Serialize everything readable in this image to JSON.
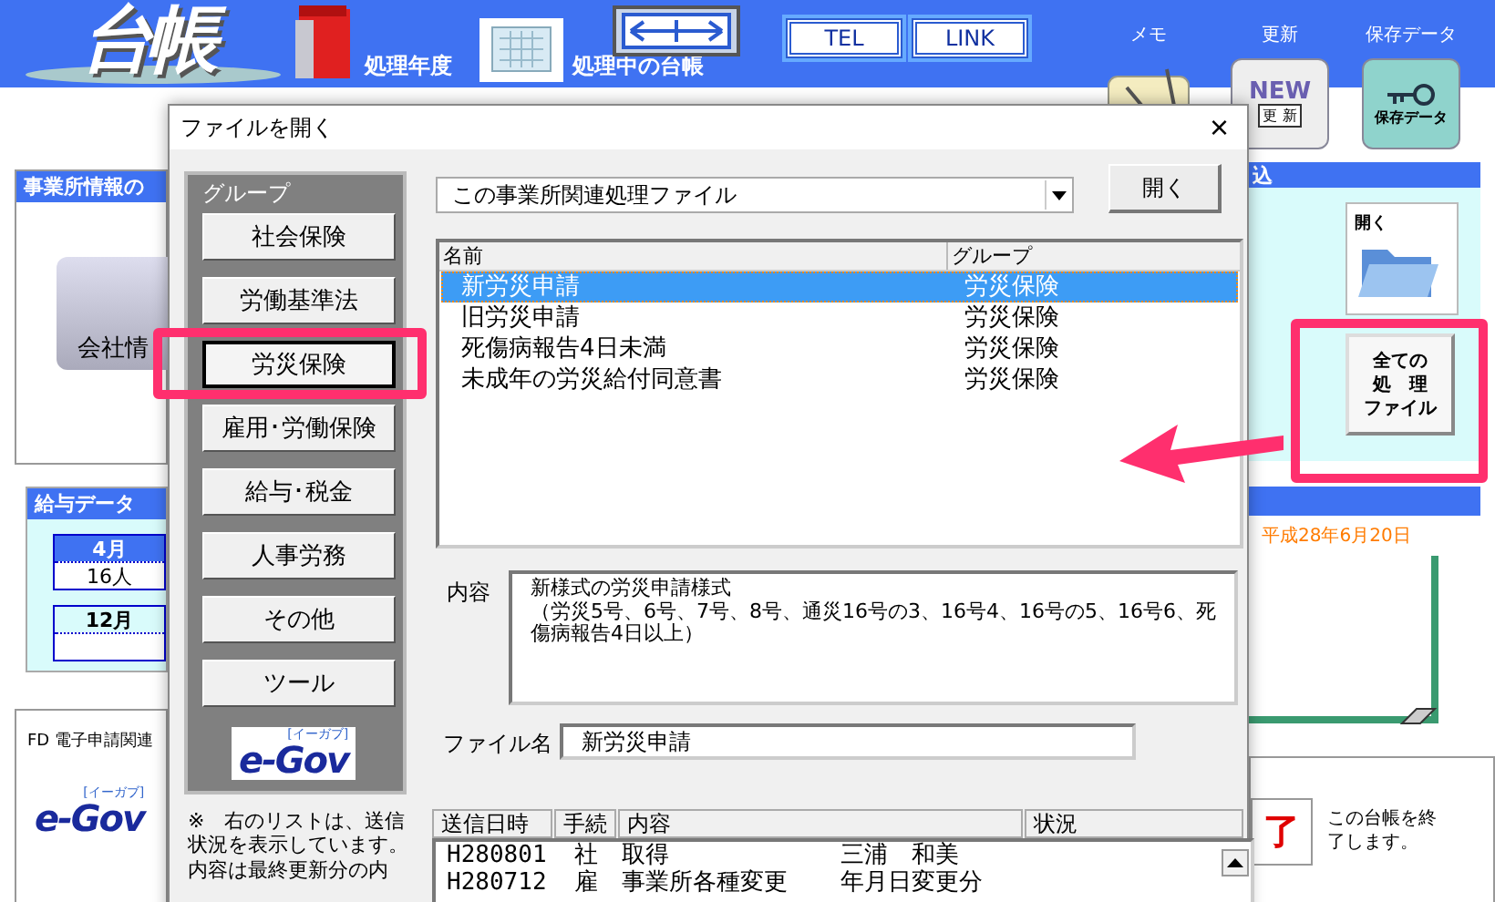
{
  "app": {
    "logo": "台帳",
    "year_label": "処理年度",
    "ledger_label": "処理中の台帳",
    "link_buttons": [
      "TEL",
      "LINK"
    ],
    "tools": [
      {
        "label": "メモ",
        "kind": "memo"
      },
      {
        "label": "更新",
        "kind": "update",
        "badge": "NEW",
        "icon_text": "更 新"
      },
      {
        "label": "保存データ",
        "kind": "save",
        "icon_text": "保存データ"
      }
    ]
  },
  "left": {
    "office_title": "事業所情報の",
    "company_label": "会社情",
    "salary_title": "給与データ",
    "salary_rows": [
      {
        "month": "4月",
        "count": "16人"
      },
      {
        "month": "12月"
      }
    ],
    "fd_title": "FD 電子申請関連",
    "egov": {
      "text": "e-Gov",
      "ruby": "[イーガブ]"
    }
  },
  "right": {
    "panel_title": "込",
    "open_label": "開く",
    "all_files_lines": [
      "全ての",
      "処　理",
      "ファイル"
    ],
    "date": "平成28年6月20日",
    "exit_mark": "了",
    "exit_note": "この台帳を終了します。"
  },
  "dialog": {
    "title": "ファイルを開く",
    "close": "×",
    "group_label": "グループ",
    "groups": [
      {
        "label": "社会保険",
        "selected": false
      },
      {
        "label": "労働基準法",
        "selected": false
      },
      {
        "label": "労災保険",
        "selected": true
      },
      {
        "label": "雇用･労働保険",
        "selected": false
      },
      {
        "label": "給与･税金",
        "selected": false
      },
      {
        "label": "人事労務",
        "selected": false
      },
      {
        "label": "その他",
        "selected": false
      },
      {
        "label": "ツール",
        "selected": false
      }
    ],
    "egov": {
      "text": "e-Gov",
      "ruby": "[イーガブ]"
    },
    "note": "※　右のリストは、送信状況を表示しています。内容は最終更新分の内",
    "source": "この事業所関連処理ファイル",
    "open_button": "開く",
    "files": {
      "columns": [
        "名前",
        "グループ"
      ],
      "rows": [
        {
          "name": "新労災申請",
          "group": "労災保険",
          "selected": true
        },
        {
          "name": "旧労災申請",
          "group": "労災保険",
          "selected": false
        },
        {
          "name": "死傷病報告4日未満",
          "group": "労災保険",
          "selected": false
        },
        {
          "name": "未成年の労災給付同意書",
          "group": "労災保険",
          "selected": false
        }
      ]
    },
    "content_label": "内容",
    "content": [
      "新様式の労災申請様式",
      "（労災5号、6号、7号、8号、通災16号の3、16号4、16号の5、16号6、死傷病報告4日以上）"
    ],
    "filename_label": "ファイル名",
    "filename": "新労災申請",
    "history": {
      "columns": [
        "送信日時",
        "手続",
        "内容",
        "状況"
      ],
      "rows": [
        {
          "date": "H280801",
          "procedure": "社",
          "content": "取得",
          "person": "三浦　和美"
        },
        {
          "date": "H280712",
          "procedure": "雇",
          "content": "事業所各種変更",
          "person": "年月日変更分"
        }
      ]
    }
  }
}
